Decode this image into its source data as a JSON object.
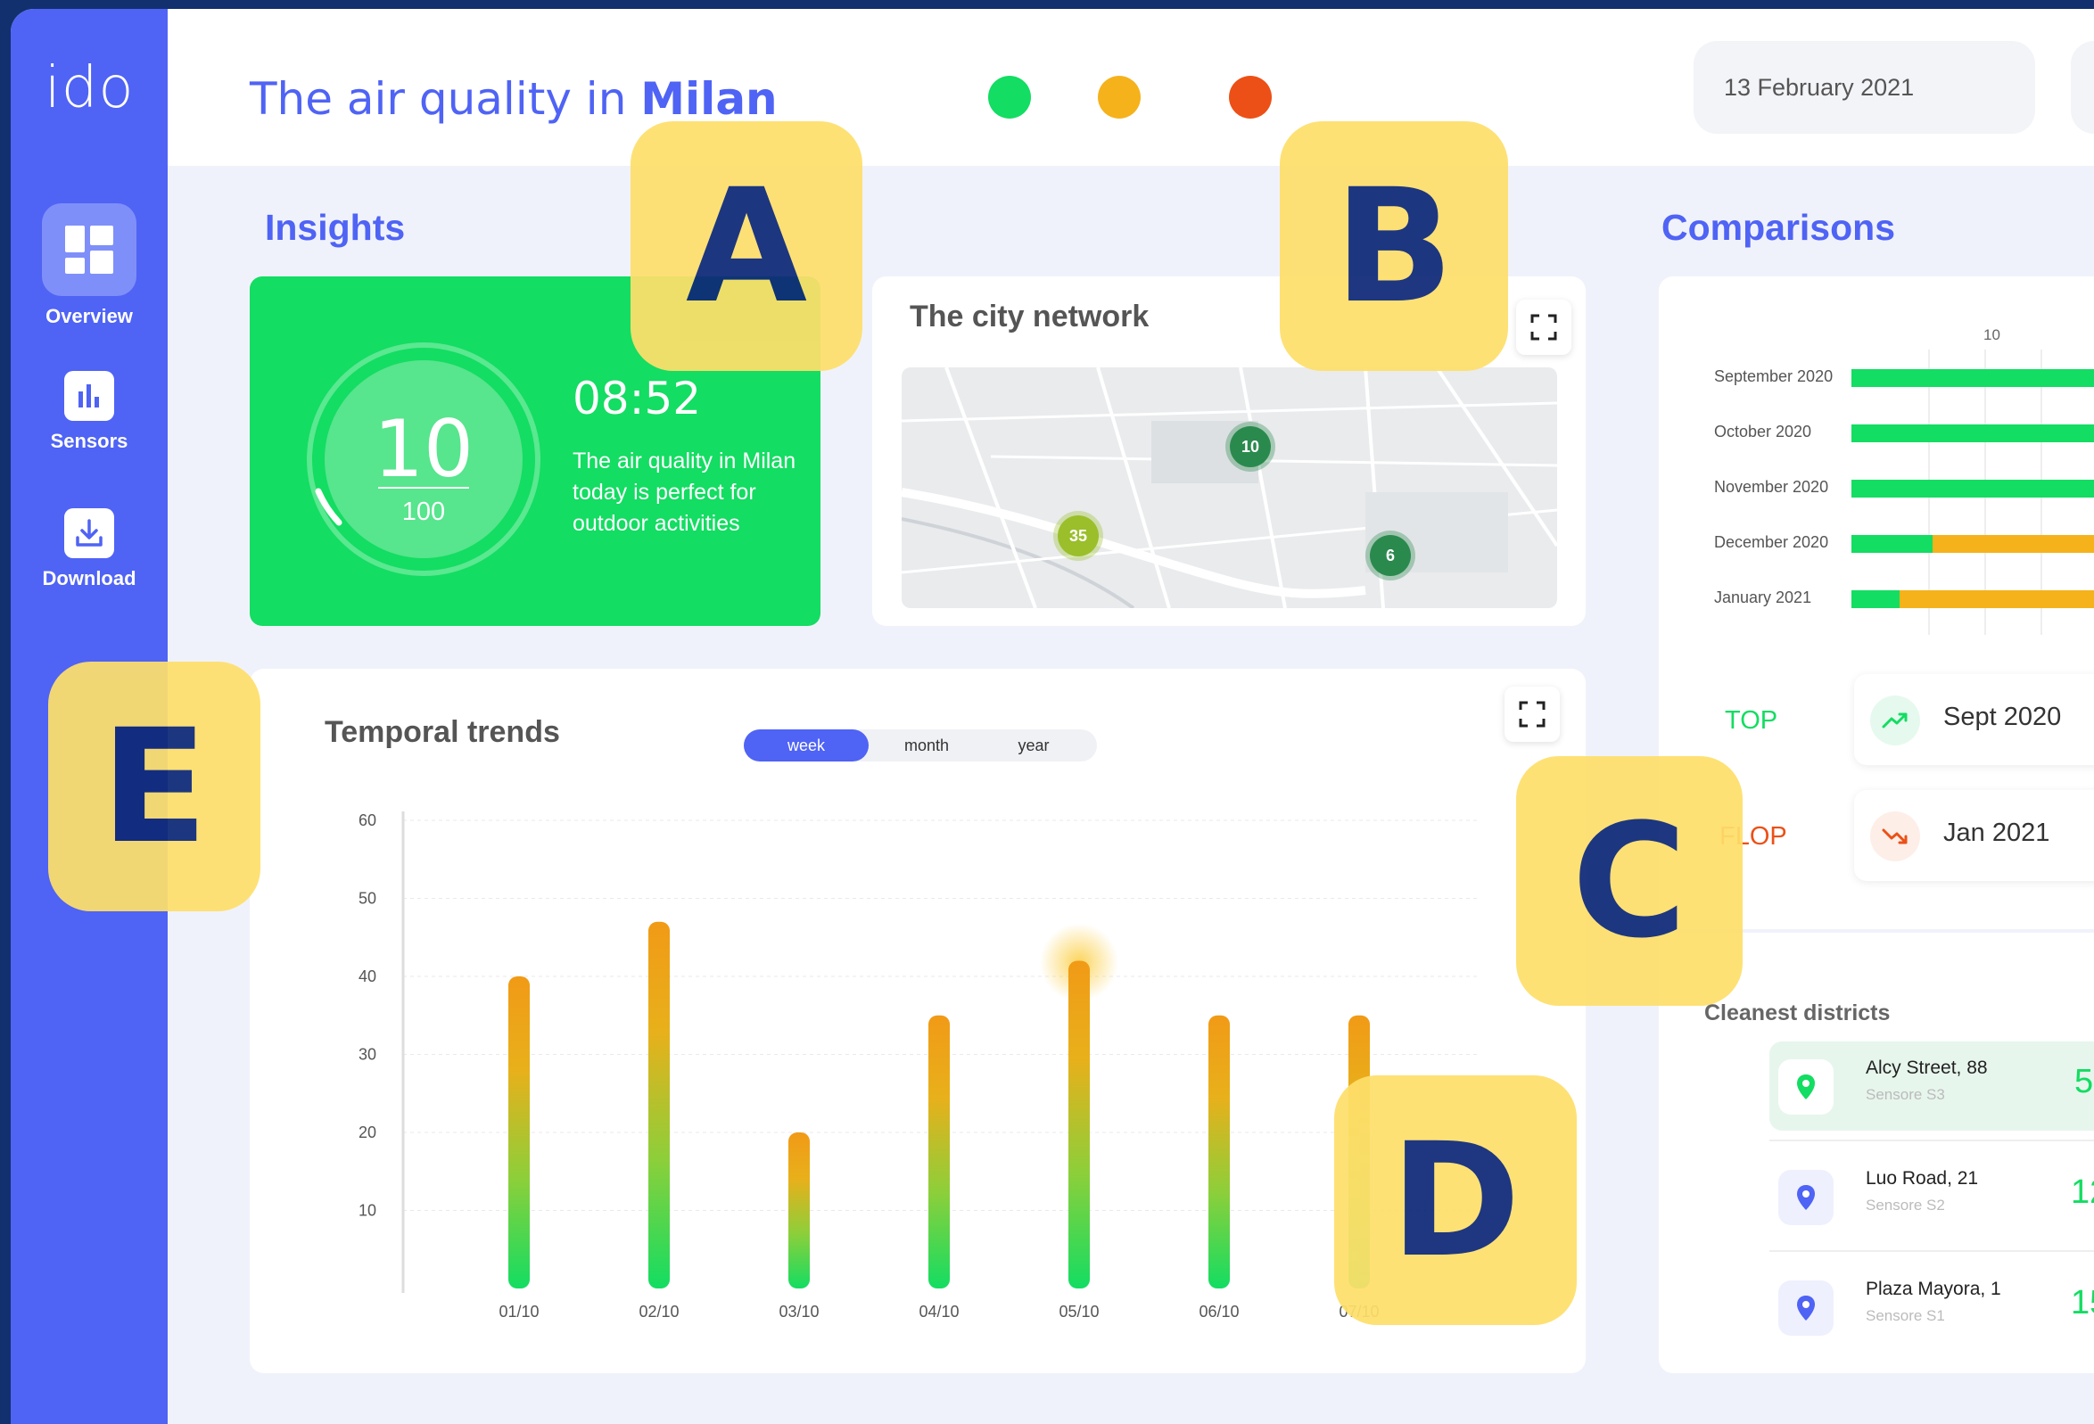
{
  "app": {
    "logo": "ido"
  },
  "sidebar": {
    "items": [
      {
        "label": "Overview",
        "icon": "dashboard-icon",
        "active": true
      },
      {
        "label": "Sensors",
        "icon": "bar-chart-icon",
        "active": false
      },
      {
        "label": "Download",
        "icon": "download-icon",
        "active": false
      }
    ]
  },
  "header": {
    "title_prefix": "The air quality in ",
    "title_city": "Milan",
    "status_colors": [
      "#13dd62",
      "#f5b21b",
      "#ec5016"
    ],
    "date": "13 February 2021"
  },
  "insights": {
    "section_title": "Insights",
    "gauge_value": "10",
    "gauge_max": "100",
    "gauge_fraction": 0.1,
    "time": "08:52",
    "description": "The air quality in Milan today is perfect for outdoor activities"
  },
  "city_network": {
    "title": "The city network",
    "markers": [
      {
        "label": "10",
        "color": "#2a8a4d"
      },
      {
        "label": "35",
        "color": "#9abf2a"
      },
      {
        "label": "6",
        "color": "#2a8a4d"
      }
    ]
  },
  "temporal_trends": {
    "title": "Temporal trends",
    "tabs": [
      "week",
      "month",
      "year"
    ],
    "active_tab": "week"
  },
  "chart_data": {
    "type": "bar",
    "title": "Temporal trends",
    "categories": [
      "01/10",
      "02/10",
      "03/10",
      "04/10",
      "05/10",
      "06/10",
      "07/10"
    ],
    "values": [
      40,
      47,
      20,
      35,
      42,
      35,
      35
    ],
    "yticks": [
      10,
      20,
      30,
      40,
      50,
      60
    ],
    "ylim": [
      0,
      60
    ],
    "grid": true,
    "highlight_category": "05/10"
  },
  "comparisons": {
    "section_title": "Comparisons",
    "axis_tick": "10",
    "months": [
      {
        "label": "September 2020",
        "green_fraction": 1.0
      },
      {
        "label": "October 2020",
        "green_fraction": 1.0
      },
      {
        "label": "November 2020",
        "green_fraction": 1.0
      },
      {
        "label": "December 2020",
        "green_fraction": 0.32
      },
      {
        "label": "January 2021",
        "green_fraction": 0.19
      }
    ],
    "top_label": "TOP",
    "top_value": "Sept 2020",
    "flop_label": "FLOP",
    "flop_value": "Jan 2021"
  },
  "cleanest_districts": {
    "title": "Cleanest districts",
    "items": [
      {
        "name": "Alcy Street, 88",
        "sensor": "Sensore S3",
        "value": "5"
      },
      {
        "name": "Luo Road, 21",
        "sensor": "Sensore S2",
        "value": "12"
      },
      {
        "name": "Plaza Mayora, 1",
        "sensor": "Sensore S1",
        "value": "15"
      }
    ]
  },
  "badges": [
    "A",
    "B",
    "C",
    "D",
    "E"
  ]
}
